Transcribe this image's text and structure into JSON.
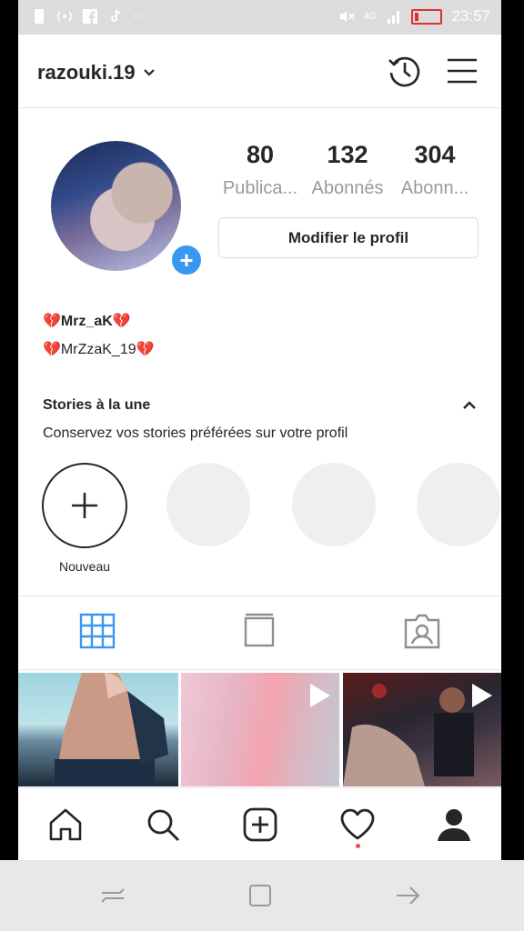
{
  "status_bar": {
    "network": "4G",
    "time": "23:57",
    "battery_color": "#e03030"
  },
  "header": {
    "username": "razouki.19"
  },
  "profile": {
    "stats": [
      {
        "value": "80",
        "label": "Publica..."
      },
      {
        "value": "132",
        "label": "Abonnés"
      },
      {
        "value": "304",
        "label": "Abonn..."
      }
    ],
    "edit_button": "Modifier le profil",
    "bio_name": "Mrz_aK",
    "bio_handle": "MrZzaK_19",
    "heart_glyph": "💔"
  },
  "stories": {
    "title": "Stories à la une",
    "subtitle": "Conservez vos stories préférées sur votre profil",
    "new_label": "Nouveau"
  },
  "tabs": [
    "grid-icon",
    "igtv-icon",
    "tagged-icon"
  ],
  "accent_color": "#3897f0",
  "bottom_nav": [
    "home-icon",
    "search-icon",
    "add-post-icon",
    "activity-heart-icon",
    "profile-icon"
  ]
}
